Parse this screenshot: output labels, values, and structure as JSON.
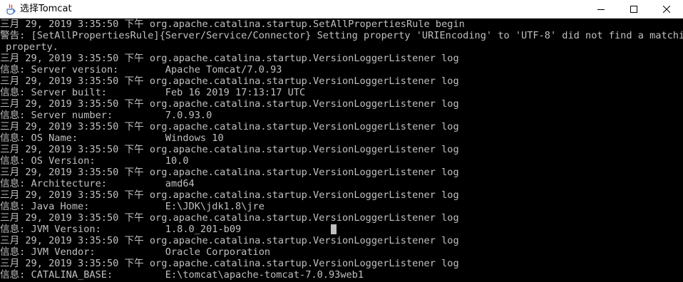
{
  "window": {
    "title": "选择Tomcat",
    "icon": "java-cup-icon",
    "controls": [
      "minimize-icon",
      "maximize-icon",
      "close-icon"
    ]
  },
  "console": {
    "text_color": "#c0c0c0",
    "background": "#000000",
    "lines": [
      "三月 29, 2019 3:35:50 下午 org.apache.catalina.startup.SetAllPropertiesRule begin",
      "警告: [SetAllPropertiesRule]{Server/Service/Connector} Setting property 'URIEncoding' to 'UTF-8' did not find a matching",
      " property.",
      "三月 29, 2019 3:35:50 下午 org.apache.catalina.startup.VersionLoggerListener log",
      "信息: Server version:        Apache Tomcat/7.0.93",
      "三月 29, 2019 3:35:50 下午 org.apache.catalina.startup.VersionLoggerListener log",
      "信息: Server built:          Feb 16 2019 17:13:17 UTC",
      "三月 29, 2019 3:35:50 下午 org.apache.catalina.startup.VersionLoggerListener log",
      "信息: Server number:         7.0.93.0",
      "三月 29, 2019 3:35:50 下午 org.apache.catalina.startup.VersionLoggerListener log",
      "信息: OS Name:               Windows 10",
      "三月 29, 2019 3:35:50 下午 org.apache.catalina.startup.VersionLoggerListener log",
      "信息: OS Version:            10.0",
      "三月 29, 2019 3:35:50 下午 org.apache.catalina.startup.VersionLoggerListener log",
      "信息: Architecture:          amd64",
      "三月 29, 2019 3:35:50 下午 org.apache.catalina.startup.VersionLoggerListener log",
      "信息: Java Home:             E:\\JDK\\jdk1.8\\jre",
      "三月 29, 2019 3:35:50 下午 org.apache.catalina.startup.VersionLoggerListener log",
      "信息: JVM Version:           1.8.0_201-b09",
      "三月 29, 2019 3:35:50 下午 org.apache.catalina.startup.VersionLoggerListener log",
      "信息: JVM Vendor:            Oracle Corporation",
      "三月 29, 2019 3:35:50 下午 org.apache.catalina.startup.VersionLoggerListener log",
      "信息: CATALINA_BASE:         E:\\tomcat\\apache-tomcat-7.0.93web1"
    ]
  }
}
